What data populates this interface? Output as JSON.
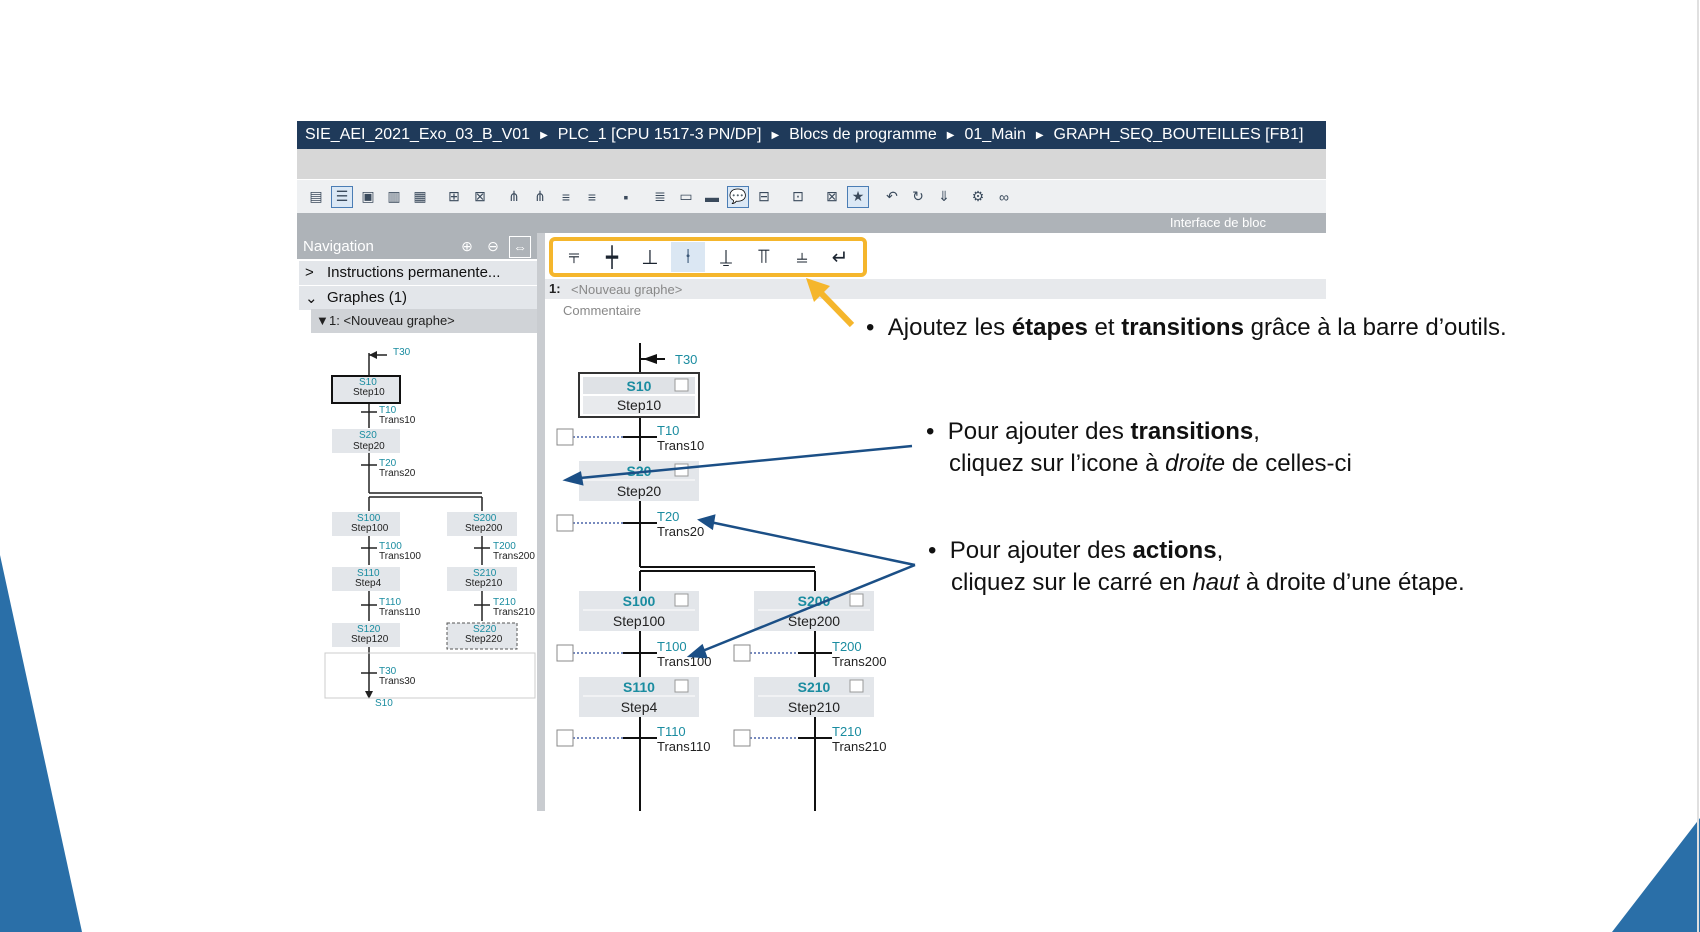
{
  "breadcrumb": [
    "SIE_AEI_2021_Exo_03_B_V01",
    "PLC_1 [CPU 1517-3 PN/DP]",
    "Blocs de programme",
    "01_Main",
    "GRAPH_SEQ_BOUTEILLES [FB1]"
  ],
  "interface_label": "Interface de bloc",
  "navigation": {
    "title": "Navigation",
    "permanent": "Instructions permanente...",
    "graphs": "Graphes (1)",
    "graph_item": "1: <Nouveau graphe>",
    "mini": {
      "t30_top": "T30",
      "s10": "S10",
      "step10": "Step10",
      "t10": "T10",
      "trans10": "Trans10",
      "s20": "S20",
      "step20": "Step20",
      "t20": "T20",
      "trans20": "Trans20",
      "s100": "S100",
      "step100": "Step100",
      "s200": "S200",
      "step200": "Step200",
      "t100": "T100",
      "trans100": "Trans100",
      "t200": "T200",
      "trans200": "Trans200",
      "s110": "S110",
      "step4": "Step4",
      "s210": "S210",
      "step210": "Step210",
      "t110": "T110",
      "trans110": "Trans110",
      "t210": "T210",
      "trans210": "Trans210",
      "s120": "S120",
      "step120": "Step120",
      "s220": "S220",
      "step220": "Step220",
      "t30": "T30",
      "trans30": "Trans30",
      "s10_jump": "S10"
    }
  },
  "editor": {
    "graph_num": "1:",
    "graph_name": "<Nouveau graphe>",
    "comment": "Commentaire",
    "t30": "T30",
    "steps": {
      "s10": "S10",
      "step10": "Step10",
      "s20": "S20",
      "step20": "Step20",
      "s100": "S100",
      "step100": "Step100",
      "s200": "S200",
      "step200": "Step200",
      "s110": "S110",
      "step4": "Step4",
      "s210": "S210",
      "step210": "Step210"
    },
    "trans": {
      "t10": "T10",
      "trans10": "Trans10",
      "t20": "T20",
      "trans20": "Trans20",
      "t100": "T100",
      "trans100": "Trans100",
      "t200": "T200",
      "trans200": "Trans200",
      "t110": "T110",
      "trans110": "Trans110",
      "t210": "T210",
      "trans210": "Trans210"
    }
  },
  "notes": {
    "n1_a": "Ajoutez les ",
    "n1_b": "étapes",
    "n1_c": " et ",
    "n1_d": "transitions",
    "n1_e": " grâce à la barre d’outils.",
    "n2_a": "Pour ajouter des ",
    "n2_b": "transitions",
    "n2_c": ",",
    "n2_d": "cliquez sur l’icone à ",
    "n2_e": "droite",
    "n2_f": " de celles-ci",
    "n3_a": "Pour ajouter des ",
    "n3_b": "actions",
    "n3_c": ",",
    "n3_d": "cliquez sur le carré en ",
    "n3_e": "haut",
    "n3_f": " à droite d’une étape.",
    "bullet": "•"
  },
  "colors": {
    "accent_blue": "#2a6fa8",
    "arrow_blue": "#1b4f86",
    "highlight_yellow": "#f5b62c",
    "step_teal": "#1a8ca0"
  }
}
